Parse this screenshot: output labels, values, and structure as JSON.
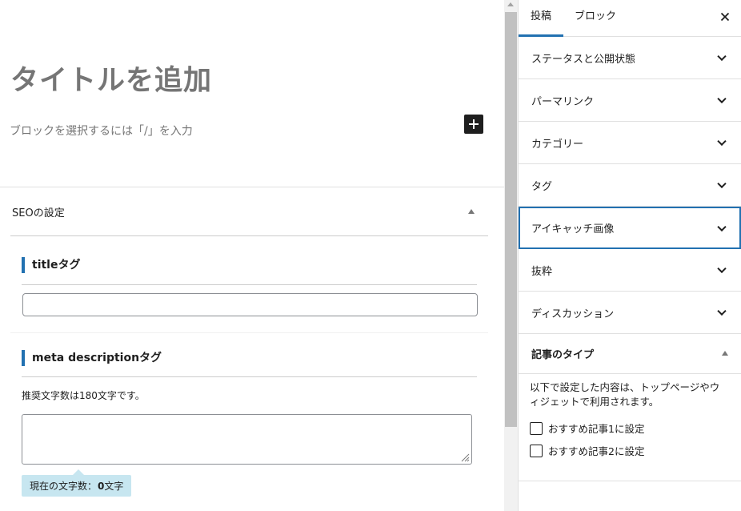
{
  "editor": {
    "title_placeholder": "タイトルを追加",
    "block_appender_placeholder": "ブロックを選択するには「/」を入力",
    "add_block_icon": "plus-icon"
  },
  "seo": {
    "section_title": "SEOの設定",
    "title_tag_label": "titleタグ",
    "title_tag_value": "",
    "meta_description_label": "meta descriptionタグ",
    "meta_description_hint": "推奨文字数は180文字です。",
    "meta_description_value": "",
    "char_count_label": "現在の文字数：",
    "char_count_value": "0",
    "char_count_unit": "文字"
  },
  "sidebar": {
    "tabs": [
      {
        "label": "投稿",
        "active": true
      },
      {
        "label": "ブロック",
        "active": false
      }
    ],
    "close_icon": "close-icon",
    "panels": [
      {
        "label": "ステータスと公開状態"
      },
      {
        "label": "パーマリンク"
      },
      {
        "label": "カテゴリー"
      },
      {
        "label": "タグ"
      },
      {
        "label": "アイキャッチ画像"
      },
      {
        "label": "抜粋"
      },
      {
        "label": "ディスカッション"
      }
    ],
    "article_type": {
      "title": "記事のタイプ",
      "description": "以下で設定した内容は、トップページやウィジェットで利用されます。",
      "options": [
        {
          "label": "おすすめ記事1に設定",
          "checked": false
        },
        {
          "label": "おすすめ記事2に設定",
          "checked": false
        }
      ]
    }
  },
  "colors": {
    "accent": "#2271b1",
    "counter_bg": "#c7e6f0"
  }
}
